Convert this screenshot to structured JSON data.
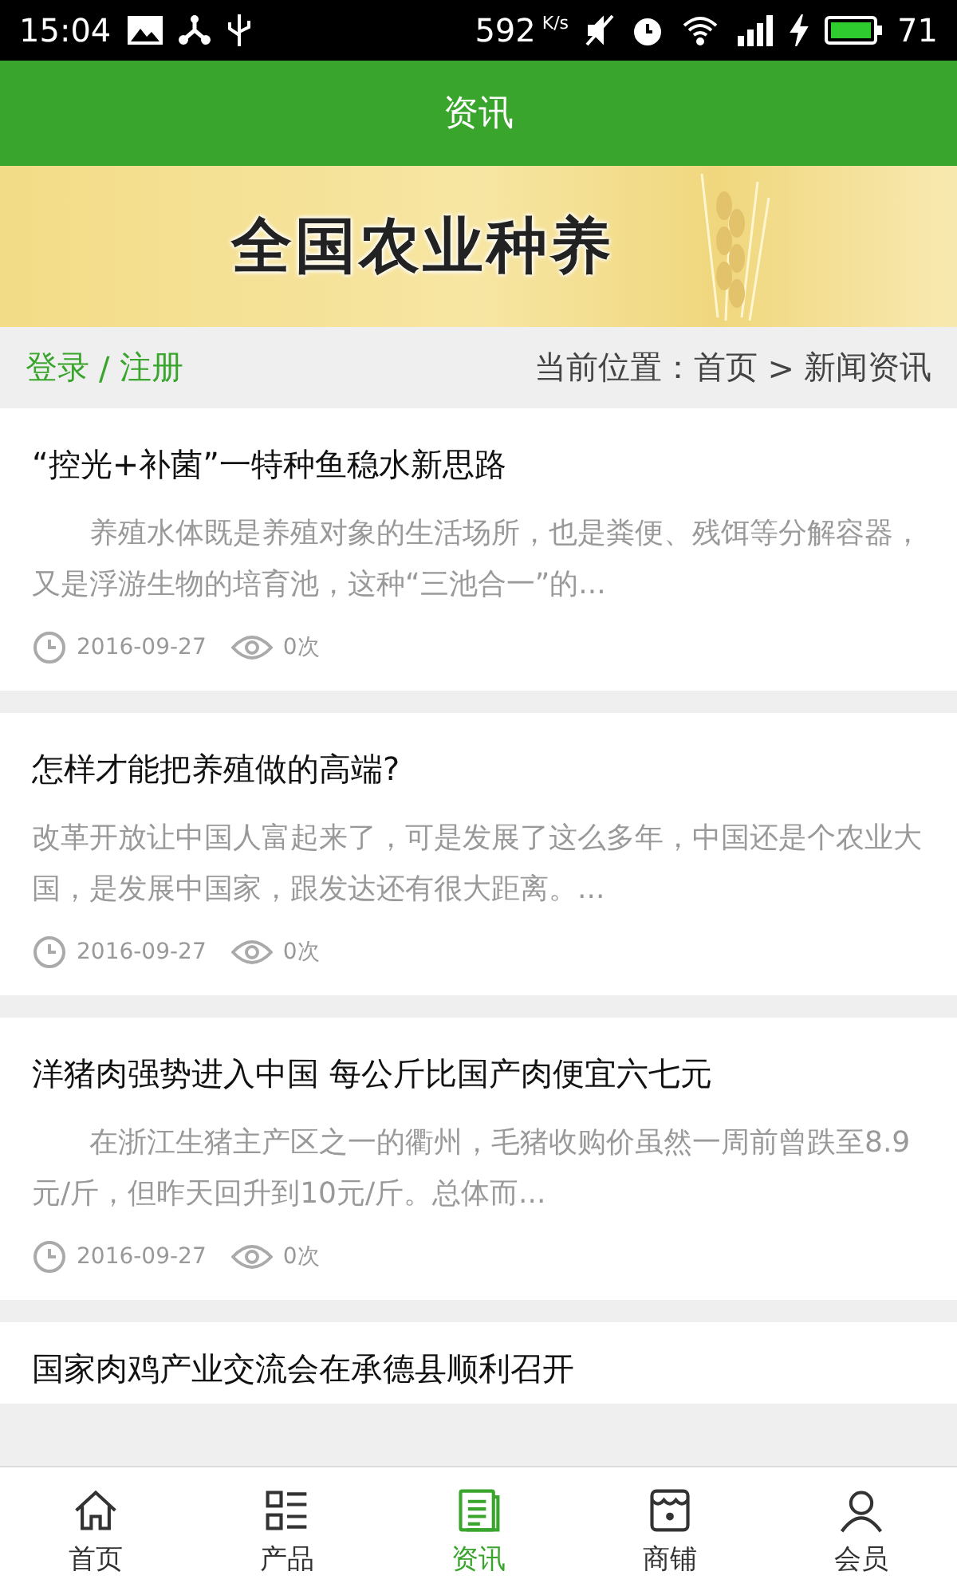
{
  "status_bar": {
    "time": "15:04",
    "speed": "592",
    "speed_unit": "K/s",
    "battery": "71"
  },
  "header": {
    "title": "资讯"
  },
  "banner": {
    "title": "全国农业种养"
  },
  "breadcrumb_bar": {
    "login": "登录",
    "separator": "/",
    "register": "注册",
    "location_label": "当前位置：",
    "home": "首页",
    "arrow": ">",
    "current": "新闻资讯"
  },
  "articles": [
    {
      "title": "“控光+补菌”一特种鱼稳水新思路",
      "summary": "养殖水体既是养殖对象的生活场所，也是粪便、残饵等分解容器，又是浮游生物的培育池，这种“三池合一”的...",
      "indented": true,
      "date": "2016-09-27",
      "views": "0次"
    },
    {
      "title": "怎样才能把养殖做的高端?",
      "summary": "改革开放让中国人富起来了，可是发展了这么多年，中国还是个农业大国，是发展中国家，跟发达还有很大距离。...",
      "indented": false,
      "date": "2016-09-27",
      "views": "0次"
    },
    {
      "title": "洋猪肉强势进入中国 每公斤比国产肉便宜六七元",
      "summary": "在浙江生猪主产区之一的衢州，毛猪收购价虽然一周前曾跌至8.9元/斤，但昨天回升到10元/斤。总体而...",
      "indented": true,
      "date": "2016-09-27",
      "views": "0次"
    },
    {
      "title": "国家肉鸡产业交流会在承德县顺利召开"
    }
  ],
  "tabs": [
    {
      "label": "首页",
      "kind": "home",
      "selected": false
    },
    {
      "label": "产品",
      "kind": "list",
      "selected": false
    },
    {
      "label": "资讯",
      "kind": "news",
      "selected": true
    },
    {
      "label": "商铺",
      "kind": "shop",
      "selected": false
    },
    {
      "label": "会员",
      "kind": "user",
      "selected": false
    }
  ]
}
